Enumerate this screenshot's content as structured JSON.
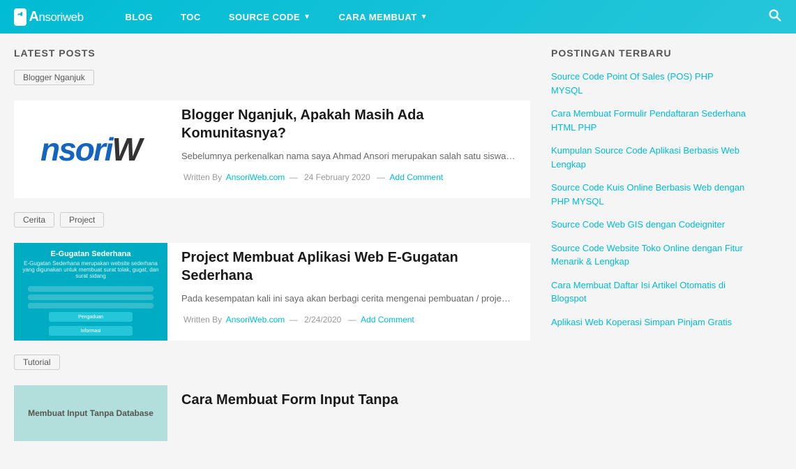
{
  "header": {
    "logo_text": "Ansoriweb",
    "logo_icon": "A",
    "nav_items": [
      {
        "label": "BLOG",
        "has_dropdown": false
      },
      {
        "label": "TOC",
        "has_dropdown": false
      },
      {
        "label": "SOURCE CODE",
        "has_dropdown": true
      },
      {
        "label": "CARA MEMBUAT",
        "has_dropdown": true
      }
    ]
  },
  "main": {
    "latest_posts_title": "LATEST POSTS",
    "posts": [
      {
        "tags": [
          "Blogger Nganjuk"
        ],
        "title": "Blogger Nganjuk, Apakah Masih Ada Komunitasnya?",
        "excerpt": "Sebelumnya perkenalkan nama saya Ahmad Ansori merupakan salah satu siswa…",
        "author": "AnsoriWeb.com",
        "date": "24 February 2020",
        "comment_label": "Add Comment",
        "thumb_type": "blogger"
      },
      {
        "tags": [
          "Cerita",
          "Project"
        ],
        "title": "Project Membuat Aplikasi Web E-Gugatan Sederhana",
        "excerpt": "Pada kesempatan kali ini saya akan berbagi cerita mengenai pembuatan / proje…",
        "author": "AnsoriWeb.com",
        "date": "2/24/2020",
        "comment_label": "Add Comment",
        "thumb_type": "egugatan",
        "egugatan_title": "E-Gugatan Sederhana",
        "egugatan_subtitle": "E-Gugatan Sederhana merupakan website sederhana yang digunakan untuk membuat surat tolak, gugat, dan surat sidang"
      },
      {
        "tags": [
          "Tutorial"
        ],
        "title": "Cara Membuat Form Input Tanpa",
        "excerpt": "",
        "author": "",
        "date": "",
        "comment_label": "",
        "thumb_type": "tutorial",
        "tutorial_text": "Membuat Input Tanpa Database"
      }
    ]
  },
  "sidebar": {
    "title": "POSTINGAN TERBARU",
    "links": [
      "Source Code Point Of Sales (POS) PHP MYSQL",
      "Cara Membuat Formulir Pendaftaran Sederhana HTML PHP",
      "Kumpulan Source Code Aplikasi Berbasis Web Lengkap",
      "Source Code Kuis Online Berbasis Web dengan PHP MYSQL",
      "Source Code Web GIS dengan Codeigniter",
      "Source Code Website Toko Online dengan Fitur Menarik & Lengkap",
      "Cara Membuat Daftar Isi Artikel Otomatis di Blogspot",
      "Aplikasi Web Koperasi Simpan Pinjam Gratis"
    ]
  }
}
